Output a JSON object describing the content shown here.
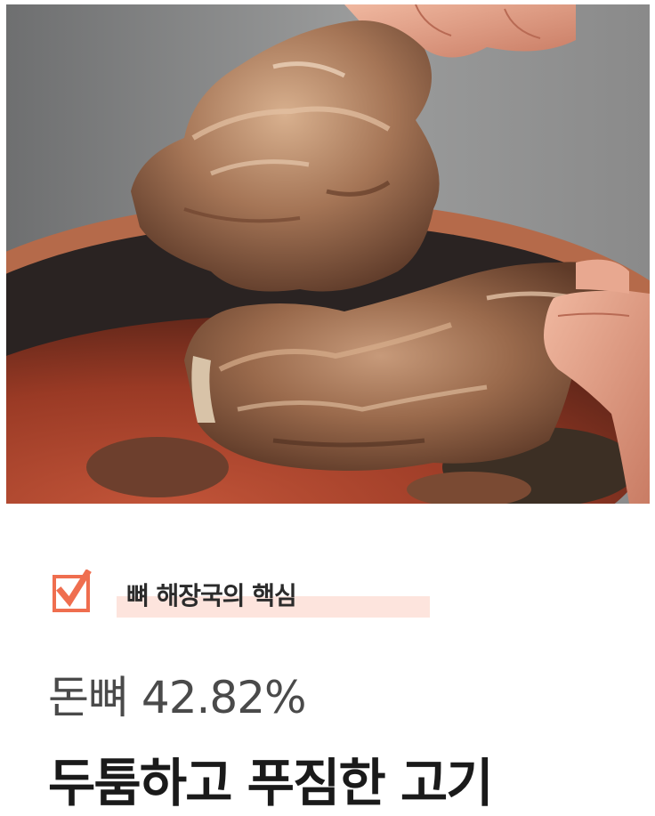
{
  "hero": {
    "image": "pork-bone-meat-photo",
    "palette": {
      "background": "#8a8c8d",
      "bowl": "#2a2322",
      "broth": "#a2432b",
      "meat": "#9a6a4c",
      "skin": "#e3a389"
    }
  },
  "badge": {
    "icon": "checkbox-check-icon",
    "label": "뼈 해장국의 핵심",
    "accent_color": "#ef6e4f",
    "highlight_color": "#fde4dd"
  },
  "stat": {
    "text": "돈뼈 42.82%"
  },
  "headline": {
    "text": "두툼하고 푸짐한 고기"
  }
}
